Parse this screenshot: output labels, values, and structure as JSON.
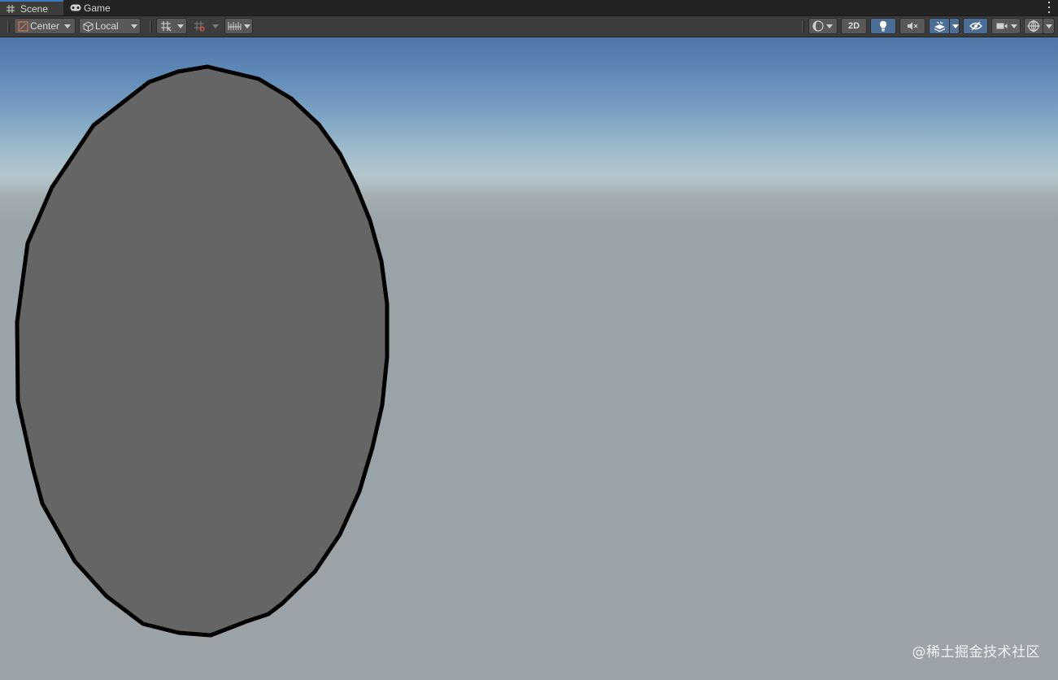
{
  "tabs": [
    {
      "label": "Scene",
      "icon": "grid-icon",
      "active": true
    },
    {
      "label": "Game",
      "icon": "gamepad-icon",
      "active": false
    }
  ],
  "toolbar": {
    "pivot_mode": "Center",
    "pivot_rotation": "Local",
    "mode_2d": "2D"
  },
  "watermark": "@稀土掘金技术社区",
  "colors": {
    "tab_accent": "#3a79bb",
    "active_button": "#4a6e96",
    "disc_fill": "#656565",
    "disc_outline": "#000000"
  }
}
